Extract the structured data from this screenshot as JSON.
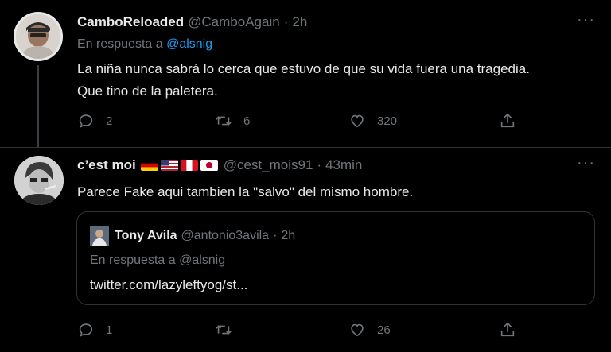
{
  "tweets": [
    {
      "name": "CamboReloaded",
      "handle": "@CamboAgain",
      "time": "2h",
      "reply_prefix": "En respuesta a ",
      "reply_handle": "@alsnig",
      "text_line1": "La niña nunca sabrá lo cerca que estuvo de que su vida fuera una tragedia.",
      "text_line2": "Que tino de la paletera.",
      "replies": "2",
      "retweets": "6",
      "likes": "320",
      "more": "···"
    },
    {
      "name": "c’est moi",
      "flags": [
        "germany-flag",
        "usa-flag",
        "peru-flag",
        "japan-flag"
      ],
      "handle": "@cest_mois91",
      "time": "43min",
      "text": "Parece Fake aqui tambien la \"salvo\" del mismo hombre.",
      "replies": "1",
      "retweets": "",
      "likes": "26",
      "more": "···",
      "quote": {
        "name": "Tony Avila",
        "handle": "@antonio3avila",
        "time": "2h",
        "reply_line": "En respuesta a @alsnig",
        "link": "twitter.com/lazyleftyog/st..."
      }
    }
  ],
  "colors": {
    "background": "#000000",
    "secondary_text": "#71767b",
    "link": "#1d9bf0",
    "border": "#2f3336"
  }
}
